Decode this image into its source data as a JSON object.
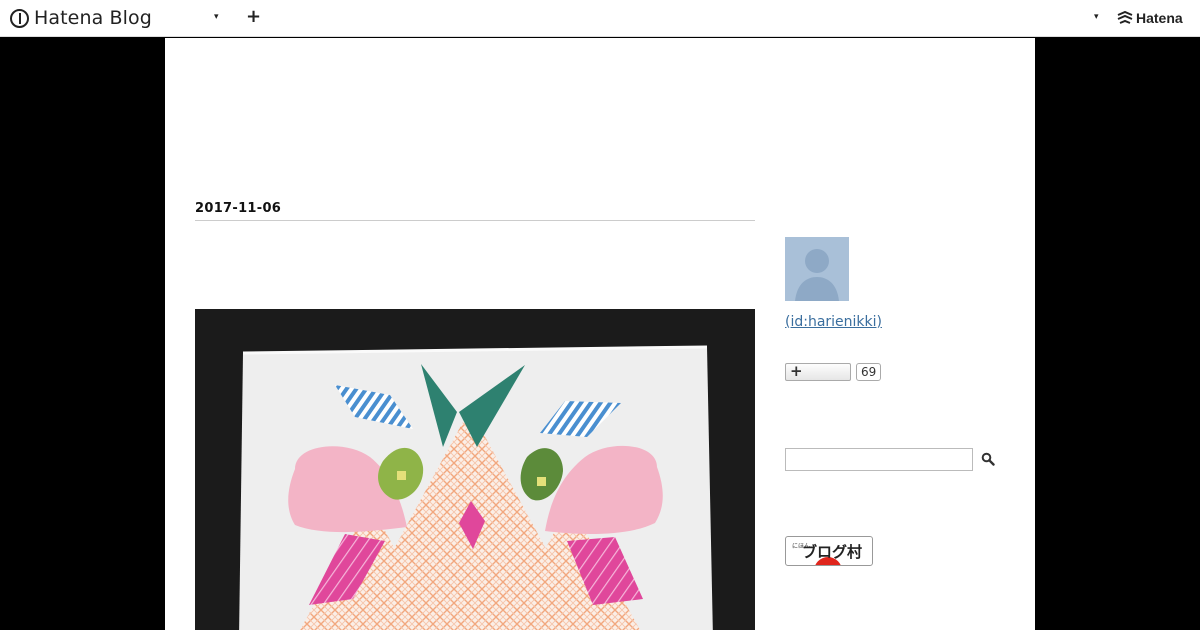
{
  "globalbar": {
    "logo_text": "Hatena Blog",
    "caret": "▾",
    "plus": "+",
    "brand_text": "Hatena"
  },
  "entry": {
    "date": "2017-11-06"
  },
  "sidebar": {
    "author": " (id:harienikki)",
    "subscribe_plus": "+",
    "subscriber_count": "69",
    "blogmura_label": "ブログ村",
    "blogmura_small": "にほん"
  },
  "colors": {
    "background": "#000000",
    "content": "#ffffff",
    "link": "#3a6e9e",
    "avatar": "#a9c0d8"
  }
}
